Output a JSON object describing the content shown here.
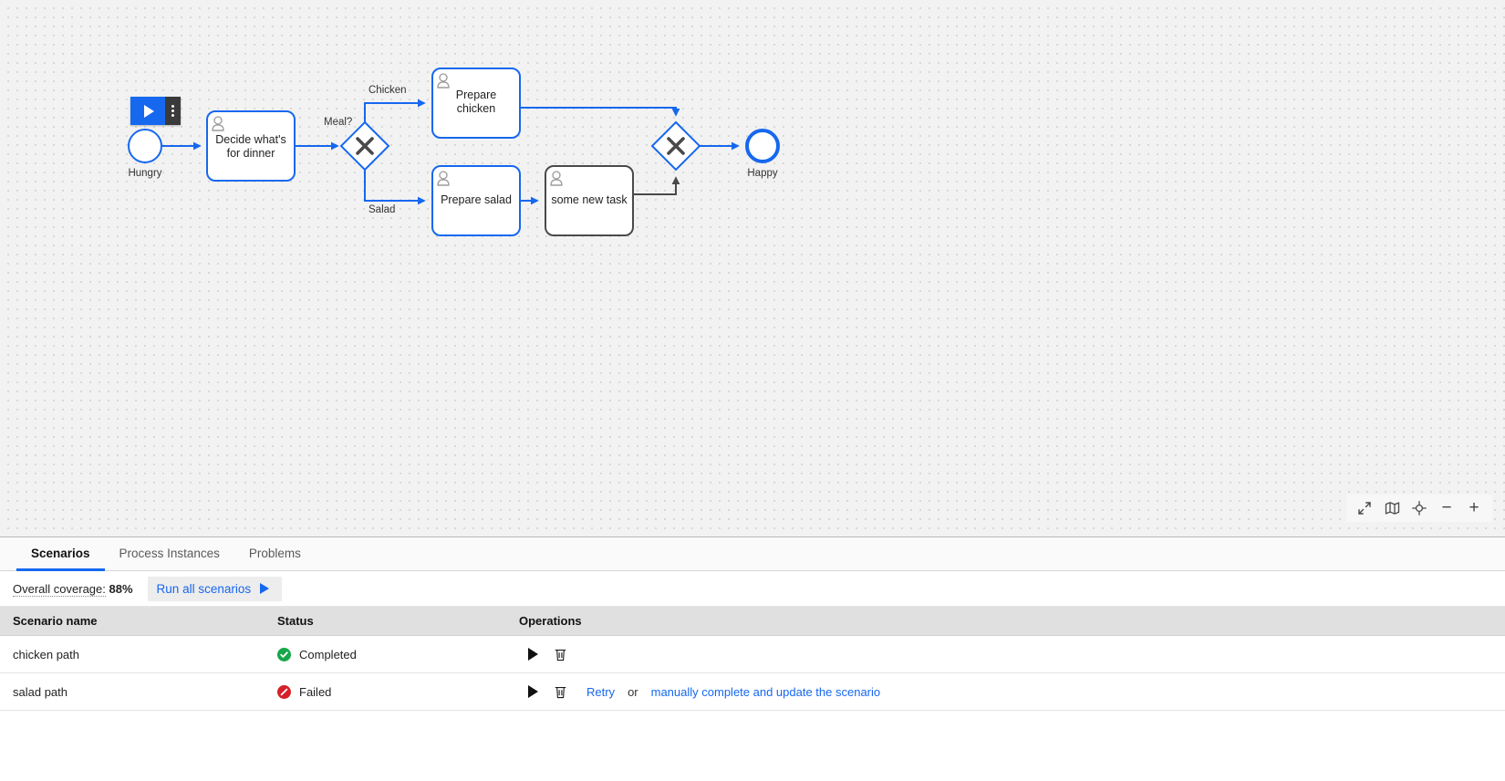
{
  "canvas": {
    "play_badge": {
      "play_icon": "play-icon",
      "menu_icon": "vertical-dots-icon"
    },
    "tools": [
      {
        "name": "fit-viewport-icon",
        "label": ""
      },
      {
        "name": "map-icon",
        "label": ""
      },
      {
        "name": "reset-zoom-icon",
        "label": ""
      },
      {
        "name": "zoom-out-icon",
        "label": "−"
      },
      {
        "name": "zoom-in-icon",
        "label": "+"
      }
    ]
  },
  "diagram": {
    "type": "bpmn",
    "nodes": [
      {
        "id": "start",
        "kind": "start-event",
        "label": "Hungry",
        "covered": true
      },
      {
        "id": "decide",
        "kind": "user-task",
        "label": "Decide what's\nfor dinner",
        "covered": true
      },
      {
        "id": "split",
        "kind": "xor-gateway",
        "label": "Meal?",
        "covered": true
      },
      {
        "id": "chicken",
        "kind": "user-task",
        "label": "Prepare\nchicken",
        "covered": true
      },
      {
        "id": "salad",
        "kind": "user-task",
        "label": "Prepare salad",
        "covered": true
      },
      {
        "id": "newtask",
        "kind": "user-task",
        "label": "some new task",
        "covered": false
      },
      {
        "id": "join",
        "kind": "xor-gateway",
        "label": "",
        "covered": true
      },
      {
        "id": "end",
        "kind": "end-event",
        "label": "Happy",
        "covered": true
      }
    ],
    "flows": [
      {
        "from": "start",
        "to": "decide",
        "label": "",
        "covered": true
      },
      {
        "from": "decide",
        "to": "split",
        "label": "",
        "covered": true
      },
      {
        "from": "split",
        "to": "chicken",
        "label": "Chicken",
        "covered": true
      },
      {
        "from": "split",
        "to": "salad",
        "label": "Salad",
        "covered": true
      },
      {
        "from": "chicken",
        "to": "join",
        "label": "",
        "covered": true
      },
      {
        "from": "salad",
        "to": "newtask",
        "label": "",
        "covered": true
      },
      {
        "from": "newtask",
        "to": "join",
        "label": "",
        "covered": false
      },
      {
        "from": "join",
        "to": "end",
        "label": "",
        "covered": true
      }
    ]
  },
  "panel": {
    "tabs": [
      {
        "label": "Scenarios",
        "active": true
      },
      {
        "label": "Process Instances",
        "active": false
      },
      {
        "label": "Problems",
        "active": false
      }
    ],
    "coverage_label": "Overall coverage:",
    "coverage_value": "88%",
    "run_all_label": "Run all scenarios",
    "table": {
      "headers": [
        "Scenario name",
        "Status",
        "Operations"
      ],
      "rows": [
        {
          "name": "chicken path",
          "status": "Completed",
          "status_kind": "ok",
          "actions": {
            "run": "run-icon",
            "delete": "delete-icon"
          },
          "links": []
        },
        {
          "name": "salad path",
          "status": "Failed",
          "status_kind": "fail",
          "actions": {
            "run": "run-icon",
            "delete": "delete-icon"
          },
          "links": [
            {
              "text": "Retry",
              "type": "link"
            },
            {
              "text": "or",
              "type": "text"
            },
            {
              "text": "manually complete and update the scenario",
              "type": "link"
            }
          ]
        }
      ]
    }
  },
  "colors": {
    "accent": "#1668ef",
    "covered": "#1668ef",
    "uncovered": "#4a4a4a",
    "success": "#17a74a",
    "failure": "#d6202a",
    "canvas_bg": "#f2f2f2"
  }
}
